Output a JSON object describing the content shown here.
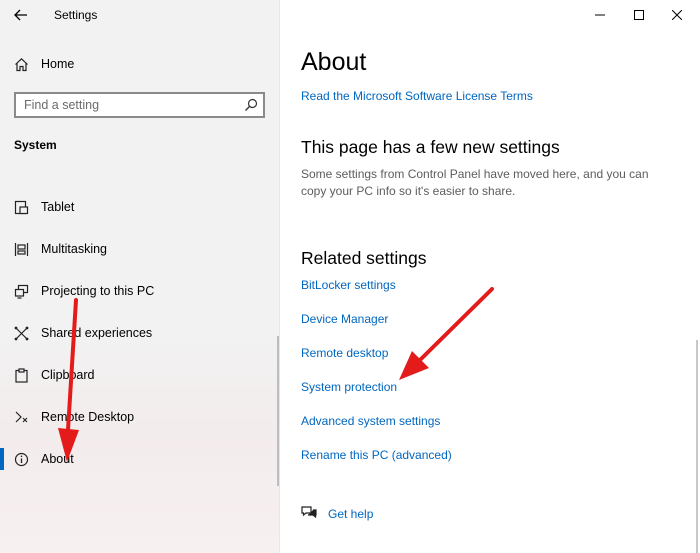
{
  "window": {
    "title": "Settings",
    "controls": {
      "minimize": "minimize-icon",
      "maximize": "maximize-icon",
      "close": "close-icon"
    }
  },
  "sidebar": {
    "home_label": "Home",
    "search_placeholder": "Find a setting",
    "section_title": "System",
    "items": [
      {
        "label": "Tablet",
        "icon": "tablet-icon"
      },
      {
        "label": "Multitasking",
        "icon": "multitasking-icon"
      },
      {
        "label": "Projecting to this PC",
        "icon": "projecting-icon"
      },
      {
        "label": "Shared experiences",
        "icon": "shared-experiences-icon"
      },
      {
        "label": "Clipboard",
        "icon": "clipboard-icon"
      },
      {
        "label": "Remote Desktop",
        "icon": "remote-desktop-icon"
      },
      {
        "label": "About",
        "icon": "info-icon",
        "selected": true
      }
    ]
  },
  "main": {
    "title": "About",
    "license_link": "Read the Microsoft Software License Terms",
    "new_settings_heading": "This page has a few new settings",
    "new_settings_desc": "Some settings from Control Panel have moved here, and you can copy your PC info so it's easier to share.",
    "related_heading": "Related settings",
    "related_links": [
      "BitLocker settings",
      "Device Manager",
      "Remote desktop",
      "System protection",
      "Advanced system settings",
      "Rename this PC (advanced)"
    ],
    "help_label": "Get help"
  },
  "colors": {
    "accent": "#0067c0",
    "annotation_arrow": "#e31b1b",
    "sidebar_bg": "#f2f2f2"
  }
}
